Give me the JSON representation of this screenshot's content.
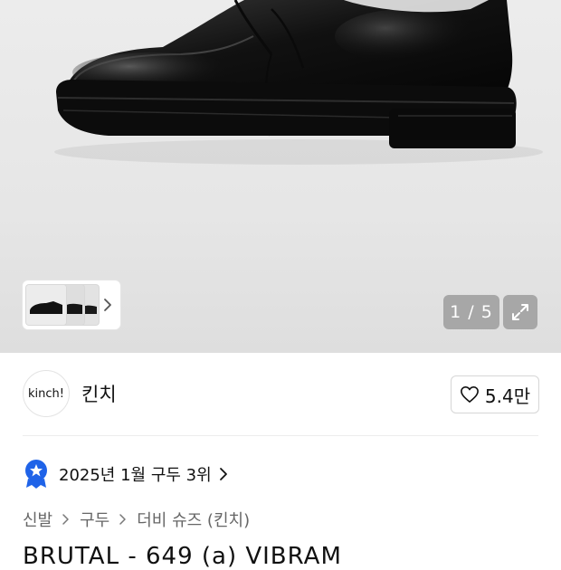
{
  "gallery": {
    "counter": "1 / 5",
    "next_thumb_icon": "chevron-right-icon",
    "expand_icon": "expand-icon"
  },
  "brand": {
    "logo_text": "kinch!",
    "name": "킨치",
    "like_count": "5.4만",
    "like_icon": "heart-outline-icon"
  },
  "ranking": {
    "text": "2025년 1월 구두 3위",
    "badge_icon": "star-medal-icon",
    "badge_color": "#1f63e8"
  },
  "breadcrumb": [
    "신발",
    "구두",
    "더비 슈즈 (킨치)"
  ],
  "product": {
    "title": "BRUTAL - 649 (a) VIBRAM"
  }
}
